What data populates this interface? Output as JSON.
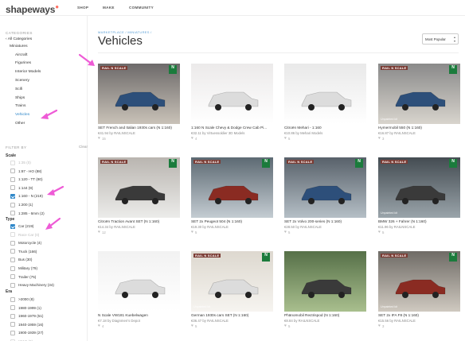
{
  "header": {
    "logo": "shapeways",
    "logo_mark": "●",
    "nav": [
      {
        "label": "SHOP"
      },
      {
        "label": "MAKE"
      },
      {
        "label": "COMMUNITY"
      }
    ]
  },
  "sidebar": {
    "categories_heading": "CATEGORIES",
    "all_categories": "‹ All Categories",
    "parent": "Miniatures",
    "items": [
      {
        "label": "Aircraft"
      },
      {
        "label": "Figurines"
      },
      {
        "label": "Interior Models"
      },
      {
        "label": "Scenery"
      },
      {
        "label": "Scifi"
      },
      {
        "label": "Ships"
      },
      {
        "label": "Trains"
      },
      {
        "label": "Vehicles"
      },
      {
        "label": "Other"
      }
    ],
    "filter_heading": "FILTER BY",
    "clear_label": "Clear",
    "scale": {
      "heading": "Scale",
      "options": [
        {
          "label": "1:35 (0)",
          "checked": false,
          "disabled": true
        },
        {
          "label": "1:87 - HO (88)",
          "checked": false,
          "disabled": false
        },
        {
          "label": "1:120 - TT (80)",
          "checked": false,
          "disabled": false
        },
        {
          "label": "1:144 (9)",
          "checked": false,
          "disabled": false
        },
        {
          "label": "1:160 - N (219)",
          "checked": true,
          "disabled": false
        },
        {
          "label": "1:200 (1)",
          "checked": false,
          "disabled": false
        },
        {
          "label": "1:285 - 6mm (2)",
          "checked": false,
          "disabled": false
        }
      ]
    },
    "type": {
      "heading": "Type",
      "options": [
        {
          "label": "Car (219)",
          "checked": true,
          "disabled": false
        },
        {
          "label": "Race Car (0)",
          "checked": false,
          "disabled": true
        },
        {
          "label": "Motorcycle (4)",
          "checked": false,
          "disabled": false
        },
        {
          "label": "Truck (166)",
          "checked": false,
          "disabled": false
        },
        {
          "label": "Bus (30)",
          "checked": false,
          "disabled": false
        },
        {
          "label": "Military (79)",
          "checked": false,
          "disabled": false
        },
        {
          "label": "Trailer (75)",
          "checked": false,
          "disabled": false
        },
        {
          "label": "Heavy Machinery (34)",
          "checked": false,
          "disabled": false
        }
      ]
    },
    "era": {
      "heading": "Era",
      "options": [
        {
          "label": ">2000 (8)",
          "checked": false,
          "disabled": false
        },
        {
          "label": "1980-1999 (1)",
          "checked": false,
          "disabled": false
        },
        {
          "label": "1960-1979 (51)",
          "checked": false,
          "disabled": false
        },
        {
          "label": "1940-1959 (16)",
          "checked": false,
          "disabled": false
        },
        {
          "label": "1900-1939 (27)",
          "checked": false,
          "disabled": false
        },
        {
          "label": "WWII (0)",
          "checked": false,
          "disabled": true
        }
      ]
    }
  },
  "main": {
    "breadcrumb": "MARKETPLACE  /  MINIATURES  /",
    "title": "Vehicles",
    "sort": {
      "selected": "Most Popular"
    },
    "products": [
      {
        "title": "SET French and Italian 1930s cars (N 1:160)",
        "meta": "€41.94 by RAILNSCALE",
        "likes": "15",
        "brand": "RAIL N SCALE",
        "badge": "N",
        "bg": "#6d6a6a",
        "bg2": "#c9c2b8"
      },
      {
        "title": "1:160 N Scale Chevy & Dodge Crew Cab Pi...",
        "meta": "€32.11 by Virtuessoldier 3D Models",
        "likes": "4",
        "bg": "#eceaea",
        "bg2": "#ffffff"
      },
      {
        "title": "Citroën Mehari - 1:160",
        "meta": "€10.86 by Mehari Models",
        "likes": "5",
        "bg": "#e9e9e9",
        "bg2": "#ffffff"
      },
      {
        "title": "Hymermobil 550 (N 1:160)",
        "meta": "€16.87 by RAILNSCALE",
        "likes": "3",
        "brand": "RAIL N SCALE",
        "badge": "N",
        "bg": "#8a8a8a",
        "bg2": "#d8d4cd",
        "caption": "Unpainted kit"
      },
      {
        "title": "Citroën Traction Avant SET (N 1:160)",
        "meta": "€14.34 by RAILNSCALE",
        "likes": "12",
        "brand": "RAIL N SCALE",
        "badge": "N",
        "bg": "#b9b5b0",
        "bg2": "#ececea"
      },
      {
        "title": "SET 2x Peugeot 504 (N 1:160)",
        "meta": "€19.30 by RAILNSCALE",
        "likes": "5",
        "brand": "RAIL N SCALE",
        "badge": "N",
        "bg": "#5d6a73",
        "bg2": "#c4ccd2"
      },
      {
        "title": "SET 2x Volvo 200-series (N 1:160)",
        "meta": "€28.50 by RAILNSCALE",
        "likes": "5",
        "brand": "RAIL N SCALE",
        "badge": "N",
        "bg": "#58616a",
        "bg2": "#b5bfc6"
      },
      {
        "title": "BMW 326 + Fahrer (N 1:160)",
        "meta": "€11.96 by RAILNSCALE",
        "likes": "5",
        "brand": "RAIL N SCALE",
        "badge": "N",
        "bg": "#444c52",
        "bg2": "#9aa4aa",
        "caption": "Unpainted kit"
      },
      {
        "title": "N Scale VW181 Kuebelwagen",
        "meta": "€7.18 by Diagnmen's Depot",
        "likes": "4",
        "bg": "#f2f2f2",
        "bg2": "#ffffff"
      },
      {
        "title": "German 1930s cars SET (N 1:160)",
        "meta": "€36.47 by RAILNSCALE",
        "likes": "5",
        "brand": "RAIL N SCALE",
        "badge": "N",
        "bg": "#ddd8cf",
        "bg2": "#f6f4f0",
        "caption": "Unpainted kit"
      },
      {
        "title": "Phänomobil Rectrispod (N 1:160)",
        "meta": "€8.84 by RAILNSCALE",
        "likes": "5",
        "bg": "#567048",
        "bg2": "#a9bf8e"
      },
      {
        "title": "SET 2x IFA F8 (N 1:160)",
        "meta": "€15.56 by RAILNSCALE",
        "likes": "3",
        "brand": "RAIL N SCALE",
        "badge": "N",
        "bg": "#6f6b66",
        "bg2": "#cfc9c0",
        "caption": "Unpainted kit"
      }
    ]
  },
  "colors": {
    "accent": "#2e87c9",
    "annotation": "#ee5bd6"
  }
}
